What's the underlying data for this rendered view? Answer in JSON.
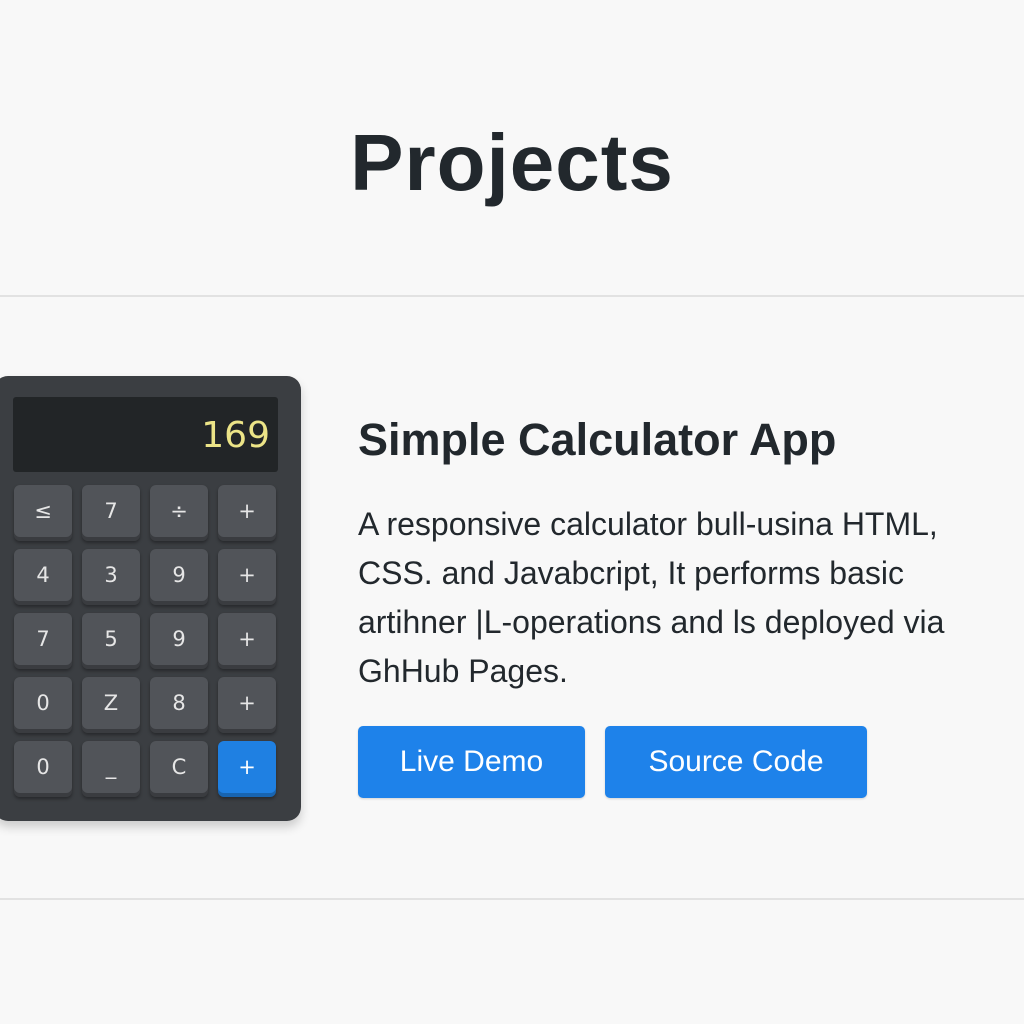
{
  "page": {
    "title": "Projects"
  },
  "project": {
    "title": "Simple Calculator App",
    "description": "A responsive calculator bull-usina HTML, CSS. and Javabcript, It performs basic artihner |L-operations and ls deployed via GhHub Pages.",
    "image": {
      "display_value": "169",
      "keys": [
        [
          "≤",
          "7",
          "÷",
          "+"
        ],
        [
          "4",
          "3",
          "9",
          "+"
        ],
        [
          "7",
          "5",
          "9",
          "+"
        ],
        [
          "0",
          "Z",
          "8",
          "+"
        ],
        [
          "0",
          "_",
          "C",
          "+"
        ]
      ],
      "accent_color": "#1f80e2",
      "display_text_color": "#ece487"
    },
    "buttons": {
      "live_demo_label": "Live Demo",
      "source_code_label": "Source Code"
    }
  },
  "colors": {
    "background": "#f8f8f8",
    "text": "#22282d",
    "button": "#1e82ea",
    "calculator_body": "#3b3e42"
  }
}
